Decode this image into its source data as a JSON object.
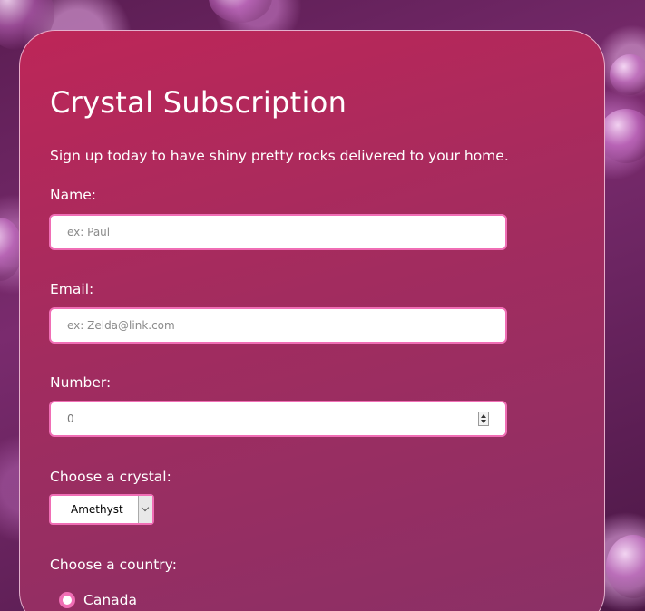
{
  "form": {
    "title": "Crystal Subscription",
    "intro": "Sign up today to have shiny pretty rocks delivered to your home.",
    "name_label": "Name:",
    "name_placeholder": "ex: Paul",
    "email_label": "Email:",
    "email_placeholder": "ex: Zelda@link.com",
    "number_label": "Number:",
    "number_value": "0",
    "crystal_label": "Choose a crystal:",
    "crystal_selected": "Amethyst",
    "country_label": "Choose a country:",
    "country_option_1": "Canada"
  },
  "colors": {
    "card_top": "#bd2658",
    "card_bottom": "#8a3066",
    "field_border": "#f06eb5",
    "text": "#ffffff"
  }
}
